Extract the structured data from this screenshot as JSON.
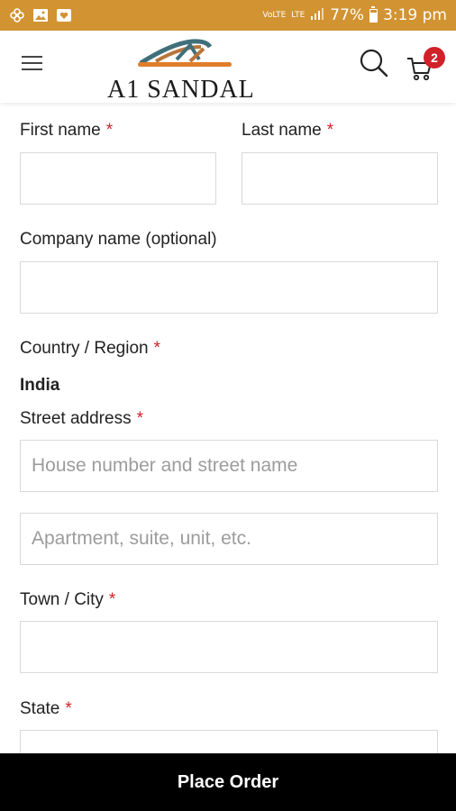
{
  "status_bar": {
    "battery": "77%",
    "time": "3:19 pm",
    "volte": "VoLTE",
    "lte": "LTE",
    "background_color": "#d29332"
  },
  "header": {
    "brand": "A1 SANDAL",
    "cart_count": "2",
    "badge_color": "#d0212a"
  },
  "form": {
    "first_name_label": "First name",
    "last_name_label": "Last name",
    "company_label": "Company name (optional)",
    "country_label": "Country / Region",
    "country_value": "India",
    "street_label": "Street address",
    "street_placeholder": "House number and street name",
    "apartment_placeholder": "Apartment, suite, unit, etc.",
    "town_label": "Town / City",
    "state_label": "State",
    "required_mark": "*"
  },
  "bottom": {
    "place_order_label": "Place Order"
  }
}
